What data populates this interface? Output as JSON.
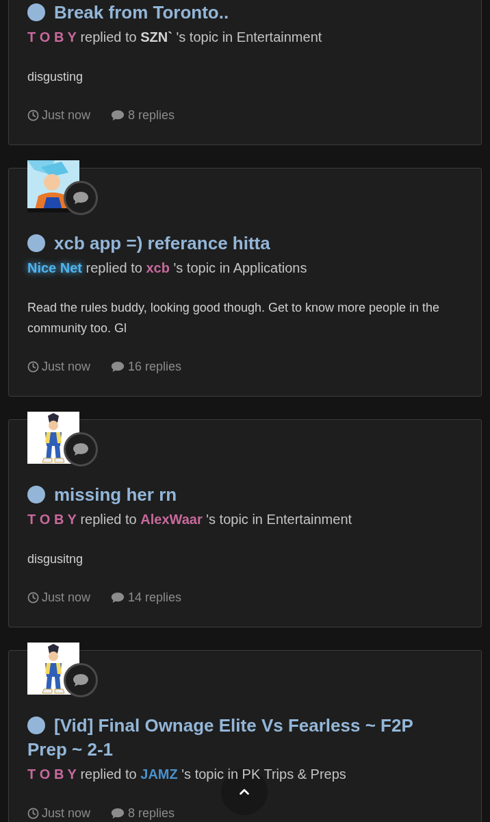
{
  "posts": [
    {
      "title": "Break from Toronto..",
      "author": {
        "name": "T O B Y",
        "color": "#c8699c",
        "glow": false
      },
      "action": "replied to",
      "target": {
        "name": "SZN`",
        "color": "#d4d4d4"
      },
      "suffix": "'s topic in Entertainment",
      "excerpt": "disgusting",
      "time": "Just now",
      "replies": "8 replies"
    },
    {
      "title": "xcb app =) referance hitta",
      "author": {
        "name": "Nice Net",
        "color": "#4fb4ee",
        "glow": true
      },
      "action": "replied to",
      "target": {
        "name": "xcb",
        "color": "#c8699c"
      },
      "suffix": "'s topic in Applications",
      "excerpt": "Read the rules buddy, looking good though. Get to know more people in the community too. Gl",
      "time": "Just now",
      "replies": "16 replies"
    },
    {
      "title": "missing her rn",
      "author": {
        "name": "T O B Y",
        "color": "#c8699c",
        "glow": false
      },
      "action": "replied to",
      "target": {
        "name": "AlexWaar",
        "color": "#c8699c"
      },
      "suffix": "'s topic in Entertainment",
      "excerpt": "disgusitng",
      "time": "Just now",
      "replies": "14 replies"
    },
    {
      "title": "[Vid] Final Ownage Elite Vs Fearless ~ F2P Prep ~ 2-1",
      "author": {
        "name": "T O B Y",
        "color": "#c8699c",
        "glow": false
      },
      "action": "replied to",
      "target": {
        "name": "JAMZ",
        "color": "#4a92cc"
      },
      "suffix": "'s topic in PK Trips & Preps",
      "time": "Just now",
      "replies": "8 replies"
    }
  ]
}
